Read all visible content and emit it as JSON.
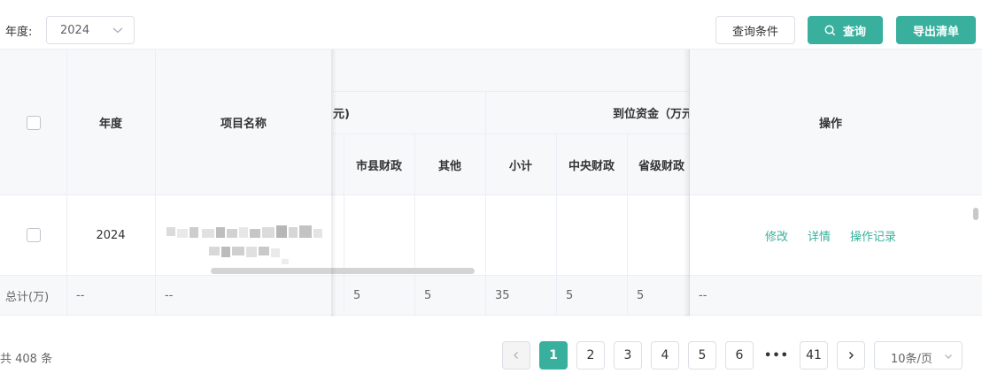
{
  "toolbar": {
    "year_label": "年度:",
    "year_value": "2024",
    "filter_button": "查询条件",
    "query_button": "查询",
    "export_button": "导出清单"
  },
  "table": {
    "headers": {
      "year": "年度",
      "project_name": "项目名称",
      "group_partial": "元)",
      "arrived_funds": "到位资金（万元）",
      "operation": "操作",
      "city_county_finance": "市县财政",
      "other": "其他",
      "subtotal": "小计",
      "central_finance": "中央财政",
      "provincial_finance": "省级财政"
    },
    "rows": [
      {
        "year": "2024",
        "actions": [
          "修改",
          "详情",
          "操作记录"
        ]
      }
    ],
    "summary": {
      "label": "总计(万)",
      "year": "--",
      "project_name": "--",
      "city_county_finance": "5",
      "other": "5",
      "subtotal": "35",
      "central_finance": "5",
      "provincial_finance": "5",
      "operation": "--"
    }
  },
  "pagination": {
    "total_text": "共 408 条",
    "pages": [
      "1",
      "2",
      "3",
      "4",
      "5",
      "6"
    ],
    "ellipsis": "•••",
    "last_page": "41",
    "current_page": "1",
    "page_size": "10条/页"
  },
  "colors": {
    "accent": "#38b09d",
    "header_bg": "#f7f8fa",
    "border": "#ebeef5"
  }
}
